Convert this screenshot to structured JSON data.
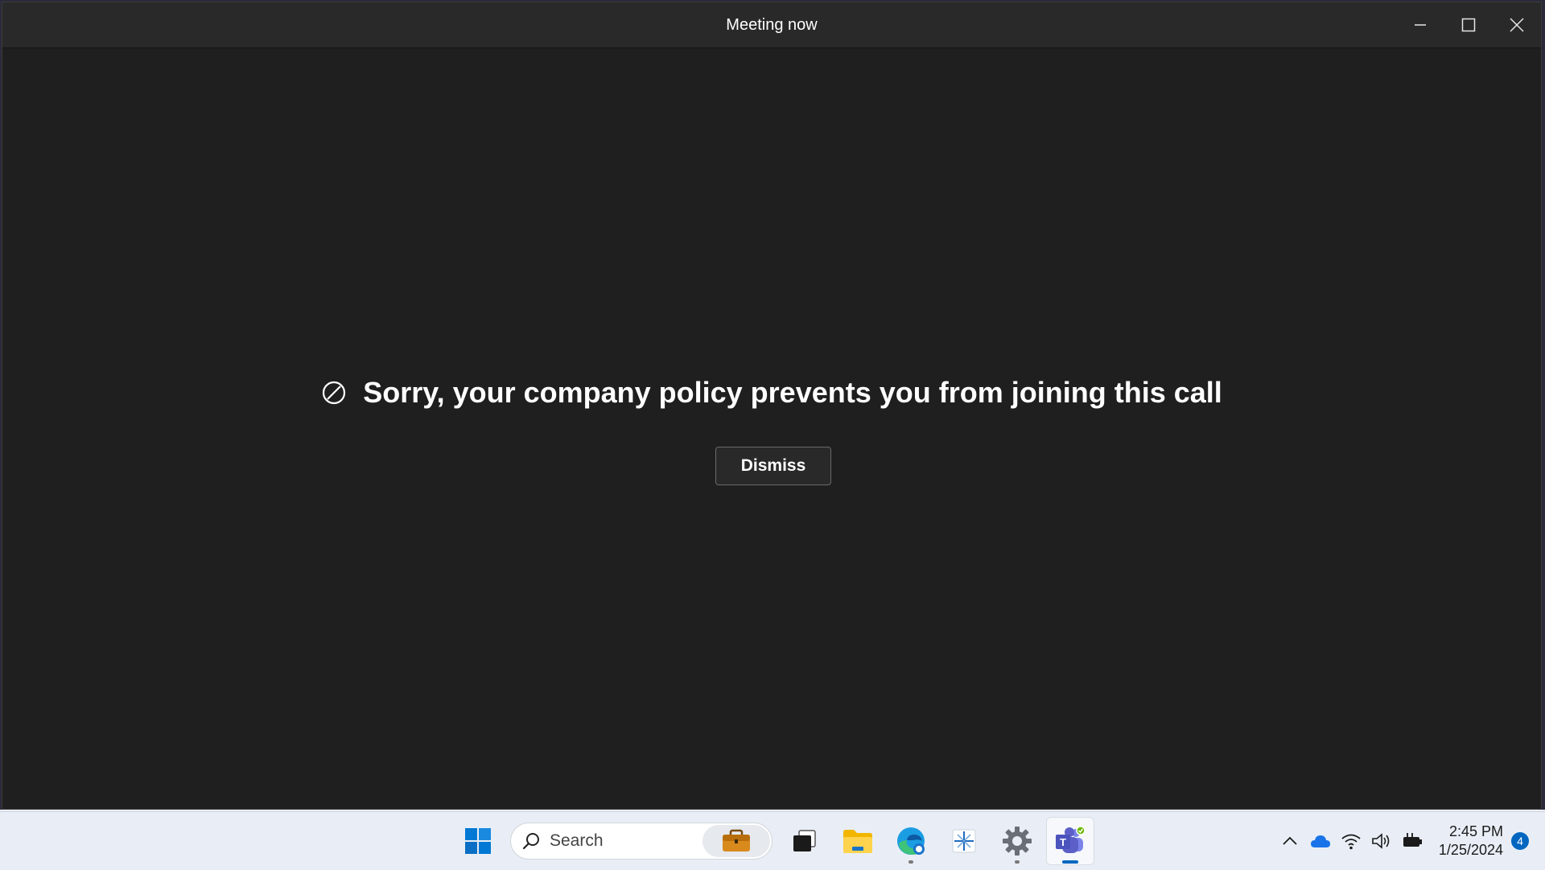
{
  "window": {
    "title": "Meeting now"
  },
  "dialog": {
    "message": "Sorry, your company policy prevents you from joining this call",
    "dismiss_label": "Dismiss"
  },
  "taskbar": {
    "search_placeholder": "Search",
    "pinned_apps": [
      "start",
      "search",
      "work-briefcase",
      "task-view",
      "file-explorer",
      "edge",
      "snipping-tool",
      "settings",
      "teams"
    ],
    "active_app": "teams"
  },
  "tray": {
    "time": "2:45 PM",
    "date": "1/25/2024",
    "notification_count": "4"
  },
  "colors": {
    "window_bg": "#1f1f1f",
    "titlebar_bg": "#292929",
    "accent": "#0067c0",
    "teams_purple": "#5b5fc7"
  }
}
